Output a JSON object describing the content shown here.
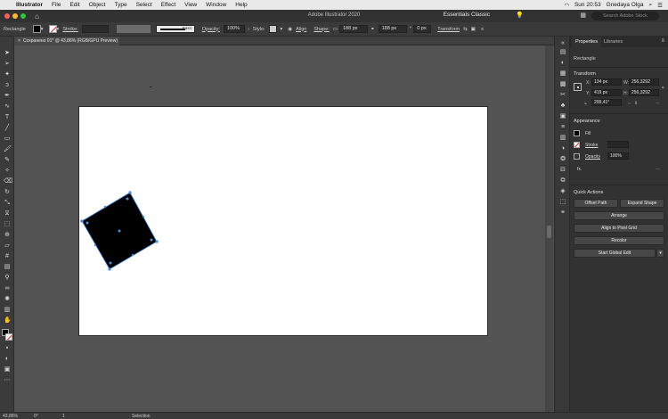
{
  "menubar": {
    "app": "Illustrator",
    "items": [
      "File",
      "Edit",
      "Object",
      "Type",
      "Select",
      "Effect",
      "View",
      "Window",
      "Help"
    ],
    "clock": "Sun 20:53",
    "user": "Gnedaya Olga"
  },
  "appbar": {
    "title": "Adobe Illustrator 2020",
    "workspace": "Essentials Classic",
    "search_placeholder": "Search Adobe Stock"
  },
  "control": {
    "object_type": "Rectangle",
    "stroke_label": "Stroke:",
    "stroke_style": "Basic",
    "opacity_label": "Opacity:",
    "opacity_value": "100%",
    "style_label": "Style:",
    "align_label": "Align",
    "shape_label": "Shape:",
    "w_value": "188 px",
    "h_value": "188 px",
    "corner_value": "0 px",
    "transform_label": "Transform"
  },
  "document": {
    "tab_title": "Сохранено 01* @ 43,86% (RGB/GPU Preview)"
  },
  "properties": {
    "tabs": [
      "Properties",
      "Libraries"
    ],
    "object_type": "Rectangle",
    "transform_title": "Transform",
    "x_label": "X:",
    "x_value": "134 px",
    "y_label": "Y:",
    "y_value": "419 px",
    "w_label": "W:",
    "w_value": "256,3292",
    "h_label": "H:",
    "h_value": "256,3292",
    "angle_value": "299,41°",
    "appearance_title": "Appearance",
    "fill_label": "Fill",
    "stroke_label": "Stroke",
    "opacity_label": "Opacity",
    "opacity_value": "100%",
    "fx_label": "fx.",
    "quick_actions_title": "Quick Actions",
    "buttons": {
      "offset_path": "Offset Path",
      "expand_shape": "Expand Shape",
      "arrange": "Arrange",
      "align_pixel": "Align to Pixel Grid",
      "recolor": "Recolor",
      "global_edit": "Start Global Edit"
    }
  },
  "status": {
    "zoom": "43,86%",
    "angle": "0°",
    "artboard": "1",
    "mode": "Selection"
  },
  "colors": {
    "selection": "#4a8fd9",
    "shape_fill": "#000000",
    "artboard": "#ffffff"
  }
}
